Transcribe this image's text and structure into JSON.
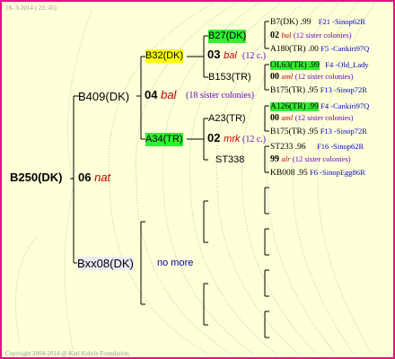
{
  "header": {
    "date": "18-  3-2014 ( 23: 45)"
  },
  "footer": {
    "copyright": "Copyright 2004-2014 @ Karl Kehrle Foundation."
  },
  "root": {
    "code": "B250(DK)",
    "gen": "06",
    "breed": "nat"
  },
  "mother": {
    "code": "B409(DK)",
    "gen": "04",
    "breed": "bal",
    "sisters": "(18 sister colonies)",
    "mother": {
      "code": "B32(DK)",
      "gen": "03",
      "breed": "bal",
      "sisters": "(12 c.)",
      "mother": {
        "code": "B27(DK)",
        "gen": "02",
        "breed": "bal",
        "sisters": "(12 sister colonies)",
        "mother": {
          "code": "B7(DK) .99",
          "place": "F21 -Sinop62R"
        },
        "father": {
          "code": "A180(TR) .00",
          "place": "F5 -Cankiri97Q"
        }
      },
      "father": {
        "code": "B153(TR)",
        "gen": "00",
        "breed": "aml",
        "sisters": "(12 sister colonies)",
        "mother": {
          "code": "OL63(TR) .99",
          "place": "F4 -Old_Lady"
        },
        "father": {
          "code": "B175(TR) .95",
          "place": "F13 -Sinop72R"
        }
      }
    },
    "father": {
      "code": "A34(TR)",
      "gen": "02",
      "breed": "mrk",
      "sisters": "(12 c.)",
      "mother": {
        "code": "A23(TR)",
        "gen": "00",
        "breed": "aml",
        "sisters": "(12 sister colonies)",
        "mother": {
          "code": "A126(TR) .99",
          "place": "F4 -Cankiri97Q"
        },
        "father": {
          "code": "B175(TR) .95",
          "place": "F13 -Sinop72R"
        }
      },
      "father": {
        "code": "ST338",
        "gen": "99",
        "breed": "alr",
        "sisters": "(12 sister colonies)",
        "mother": {
          "code": "ST233 .96",
          "place": "F16 -Sinop62R"
        },
        "father": {
          "code": "KB008 .95",
          "place": "F6 -SinopEgg86R"
        }
      }
    }
  },
  "father": {
    "code": "Bxx08(DK)",
    "note": "no more"
  }
}
